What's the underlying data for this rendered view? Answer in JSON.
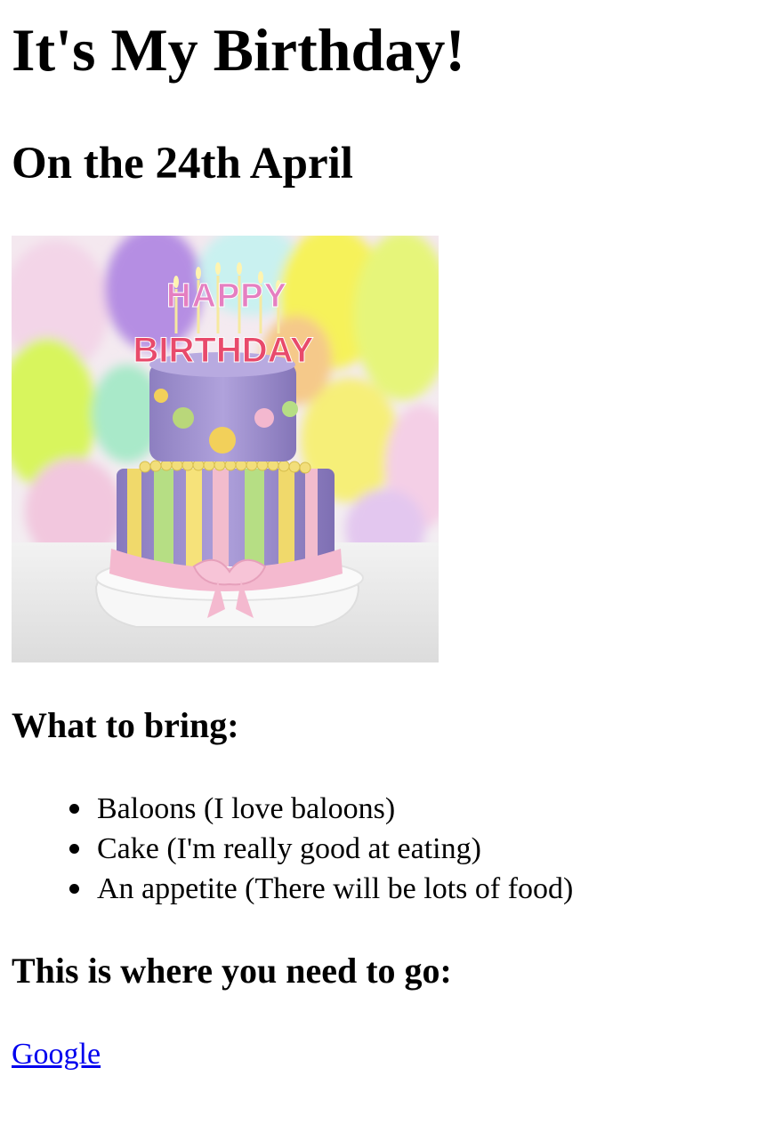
{
  "page": {
    "title": "It's My Birthday!",
    "subtitle": "On the 24th April",
    "image": {
      "alt": "Birthday cake",
      "cake_text_line1": "HAPPY",
      "cake_text_line2": "BIRTHDAY"
    },
    "bring_heading": "What to bring:",
    "bring_items": [
      "Baloons (I love baloons)",
      "Cake (I'm really good at eating)",
      "An appetite (There will be lots of food)"
    ],
    "where_heading": "This is where you need to go:",
    "link": {
      "label": "Google"
    }
  },
  "colors": {
    "link": "#0000ee",
    "text": "#000000",
    "background": "#ffffff"
  }
}
